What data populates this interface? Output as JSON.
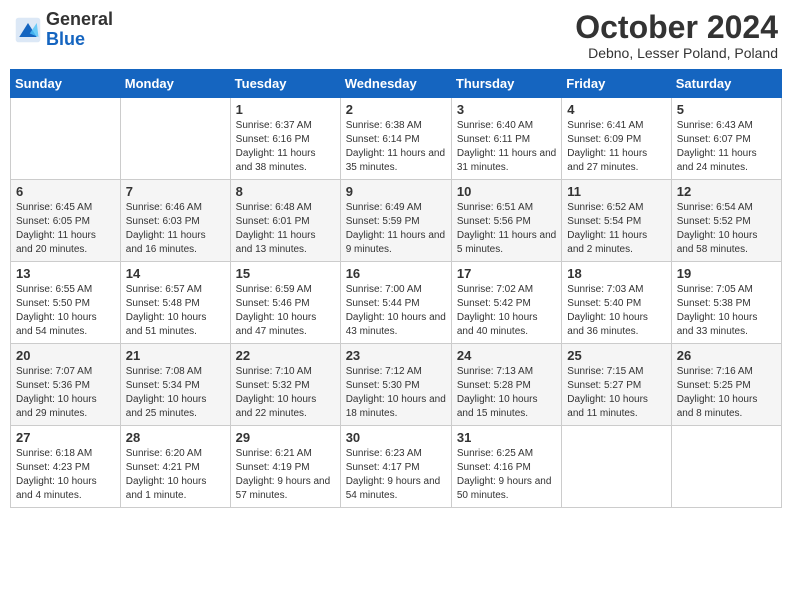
{
  "header": {
    "logo_general": "General",
    "logo_blue": "Blue",
    "month_title": "October 2024",
    "location": "Debno, Lesser Poland, Poland"
  },
  "weekdays": [
    "Sunday",
    "Monday",
    "Tuesday",
    "Wednesday",
    "Thursday",
    "Friday",
    "Saturday"
  ],
  "weeks": [
    [
      {
        "day": "",
        "info": ""
      },
      {
        "day": "",
        "info": ""
      },
      {
        "day": "1",
        "info": "Sunrise: 6:37 AM\nSunset: 6:16 PM\nDaylight: 11 hours and 38 minutes."
      },
      {
        "day": "2",
        "info": "Sunrise: 6:38 AM\nSunset: 6:14 PM\nDaylight: 11 hours and 35 minutes."
      },
      {
        "day": "3",
        "info": "Sunrise: 6:40 AM\nSunset: 6:11 PM\nDaylight: 11 hours and 31 minutes."
      },
      {
        "day": "4",
        "info": "Sunrise: 6:41 AM\nSunset: 6:09 PM\nDaylight: 11 hours and 27 minutes."
      },
      {
        "day": "5",
        "info": "Sunrise: 6:43 AM\nSunset: 6:07 PM\nDaylight: 11 hours and 24 minutes."
      }
    ],
    [
      {
        "day": "6",
        "info": "Sunrise: 6:45 AM\nSunset: 6:05 PM\nDaylight: 11 hours and 20 minutes."
      },
      {
        "day": "7",
        "info": "Sunrise: 6:46 AM\nSunset: 6:03 PM\nDaylight: 11 hours and 16 minutes."
      },
      {
        "day": "8",
        "info": "Sunrise: 6:48 AM\nSunset: 6:01 PM\nDaylight: 11 hours and 13 minutes."
      },
      {
        "day": "9",
        "info": "Sunrise: 6:49 AM\nSunset: 5:59 PM\nDaylight: 11 hours and 9 minutes."
      },
      {
        "day": "10",
        "info": "Sunrise: 6:51 AM\nSunset: 5:56 PM\nDaylight: 11 hours and 5 minutes."
      },
      {
        "day": "11",
        "info": "Sunrise: 6:52 AM\nSunset: 5:54 PM\nDaylight: 11 hours and 2 minutes."
      },
      {
        "day": "12",
        "info": "Sunrise: 6:54 AM\nSunset: 5:52 PM\nDaylight: 10 hours and 58 minutes."
      }
    ],
    [
      {
        "day": "13",
        "info": "Sunrise: 6:55 AM\nSunset: 5:50 PM\nDaylight: 10 hours and 54 minutes."
      },
      {
        "day": "14",
        "info": "Sunrise: 6:57 AM\nSunset: 5:48 PM\nDaylight: 10 hours and 51 minutes."
      },
      {
        "day": "15",
        "info": "Sunrise: 6:59 AM\nSunset: 5:46 PM\nDaylight: 10 hours and 47 minutes."
      },
      {
        "day": "16",
        "info": "Sunrise: 7:00 AM\nSunset: 5:44 PM\nDaylight: 10 hours and 43 minutes."
      },
      {
        "day": "17",
        "info": "Sunrise: 7:02 AM\nSunset: 5:42 PM\nDaylight: 10 hours and 40 minutes."
      },
      {
        "day": "18",
        "info": "Sunrise: 7:03 AM\nSunset: 5:40 PM\nDaylight: 10 hours and 36 minutes."
      },
      {
        "day": "19",
        "info": "Sunrise: 7:05 AM\nSunset: 5:38 PM\nDaylight: 10 hours and 33 minutes."
      }
    ],
    [
      {
        "day": "20",
        "info": "Sunrise: 7:07 AM\nSunset: 5:36 PM\nDaylight: 10 hours and 29 minutes."
      },
      {
        "day": "21",
        "info": "Sunrise: 7:08 AM\nSunset: 5:34 PM\nDaylight: 10 hours and 25 minutes."
      },
      {
        "day": "22",
        "info": "Sunrise: 7:10 AM\nSunset: 5:32 PM\nDaylight: 10 hours and 22 minutes."
      },
      {
        "day": "23",
        "info": "Sunrise: 7:12 AM\nSunset: 5:30 PM\nDaylight: 10 hours and 18 minutes."
      },
      {
        "day": "24",
        "info": "Sunrise: 7:13 AM\nSunset: 5:28 PM\nDaylight: 10 hours and 15 minutes."
      },
      {
        "day": "25",
        "info": "Sunrise: 7:15 AM\nSunset: 5:27 PM\nDaylight: 10 hours and 11 minutes."
      },
      {
        "day": "26",
        "info": "Sunrise: 7:16 AM\nSunset: 5:25 PM\nDaylight: 10 hours and 8 minutes."
      }
    ],
    [
      {
        "day": "27",
        "info": "Sunrise: 6:18 AM\nSunset: 4:23 PM\nDaylight: 10 hours and 4 minutes."
      },
      {
        "day": "28",
        "info": "Sunrise: 6:20 AM\nSunset: 4:21 PM\nDaylight: 10 hours and 1 minute."
      },
      {
        "day": "29",
        "info": "Sunrise: 6:21 AM\nSunset: 4:19 PM\nDaylight: 9 hours and 57 minutes."
      },
      {
        "day": "30",
        "info": "Sunrise: 6:23 AM\nSunset: 4:17 PM\nDaylight: 9 hours and 54 minutes."
      },
      {
        "day": "31",
        "info": "Sunrise: 6:25 AM\nSunset: 4:16 PM\nDaylight: 9 hours and 50 minutes."
      },
      {
        "day": "",
        "info": ""
      },
      {
        "day": "",
        "info": ""
      }
    ]
  ]
}
